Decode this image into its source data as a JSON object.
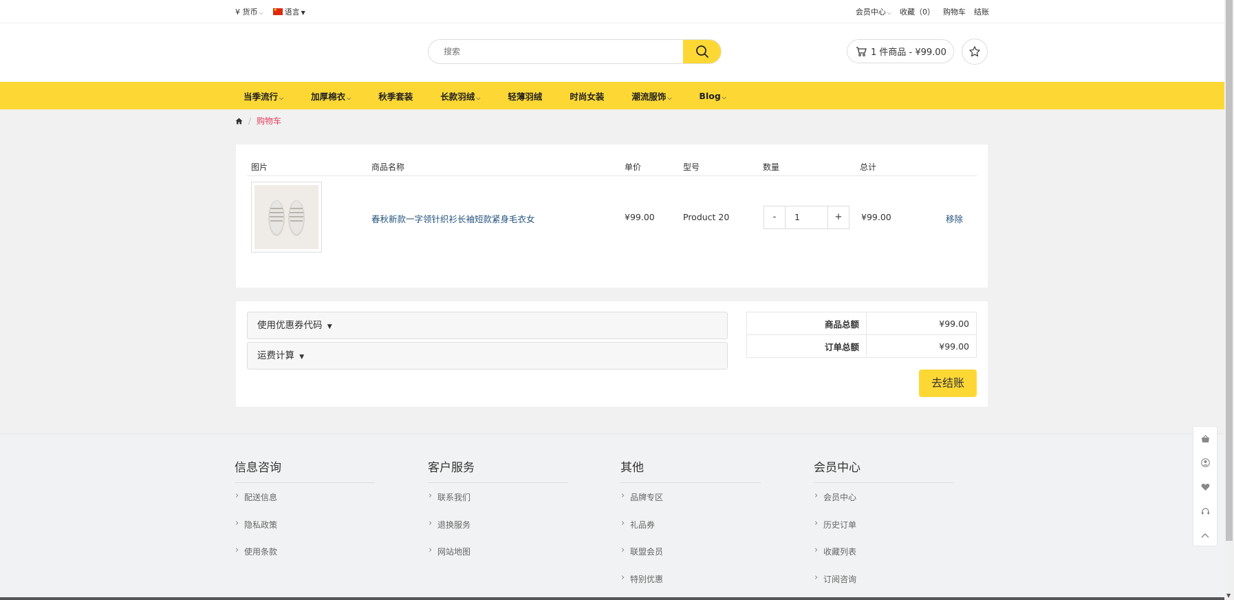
{
  "topbar": {
    "currency": "¥ 货币",
    "language": "语言",
    "member_center": "会员中心",
    "favorites": "收藏（0）",
    "cart": "购物车",
    "checkout": "结账"
  },
  "search": {
    "placeholder": "搜索"
  },
  "cart_button": {
    "label": "1 件商品 - ¥99.00"
  },
  "nav": {
    "items": [
      {
        "label": "当季流行",
        "chevron": true
      },
      {
        "label": "加厚棉衣",
        "chevron": true
      },
      {
        "label": "秋季套装"
      },
      {
        "label": "长款羽绒",
        "chevron": true
      },
      {
        "label": "轻薄羽绒"
      },
      {
        "label": "时尚女装"
      },
      {
        "label": "潮流服饰",
        "chevron": true
      },
      {
        "label": "Blog",
        "chevron": true
      }
    ]
  },
  "breadcrumb": {
    "current": "购物车"
  },
  "cart_table": {
    "headers": {
      "image": "图片",
      "name": "商品名称",
      "price": "单价",
      "model": "型号",
      "quantity": "数量",
      "total": "总计"
    },
    "rows": [
      {
        "name": "春秋新款一字领针织衫长袖短款紧身毛衣女",
        "price": "¥99.00",
        "model": "Product 20",
        "minus": "-",
        "quantity": "1",
        "plus": "+",
        "total": "¥99.00",
        "remove": "移除"
      }
    ]
  },
  "coupon": {
    "label": "使用优惠券代码"
  },
  "shipping": {
    "label": "运费计算"
  },
  "summary": {
    "subtotal_label": "商品总额",
    "subtotal_value": "¥99.00",
    "total_label": "订单总额",
    "total_value": "¥99.00"
  },
  "checkout_button": "去结账",
  "footer": {
    "columns": [
      {
        "title": "信息咨询",
        "links": [
          "配送信息",
          "隐私政策",
          "使用条款"
        ]
      },
      {
        "title": "客户服务",
        "links": [
          "联系我们",
          "退换服务",
          "网站地图"
        ]
      },
      {
        "title": "其他",
        "links": [
          "品牌专区",
          "礼品券",
          "联盟会员",
          "特别优惠"
        ]
      },
      {
        "title": "会员中心",
        "links": [
          "会员中心",
          "历史订单",
          "收藏列表",
          "订阅咨询"
        ]
      }
    ]
  },
  "colors": {
    "accent": "#fdd835",
    "link": "#23527c",
    "breadcrumb_active": "#e53e5e"
  }
}
